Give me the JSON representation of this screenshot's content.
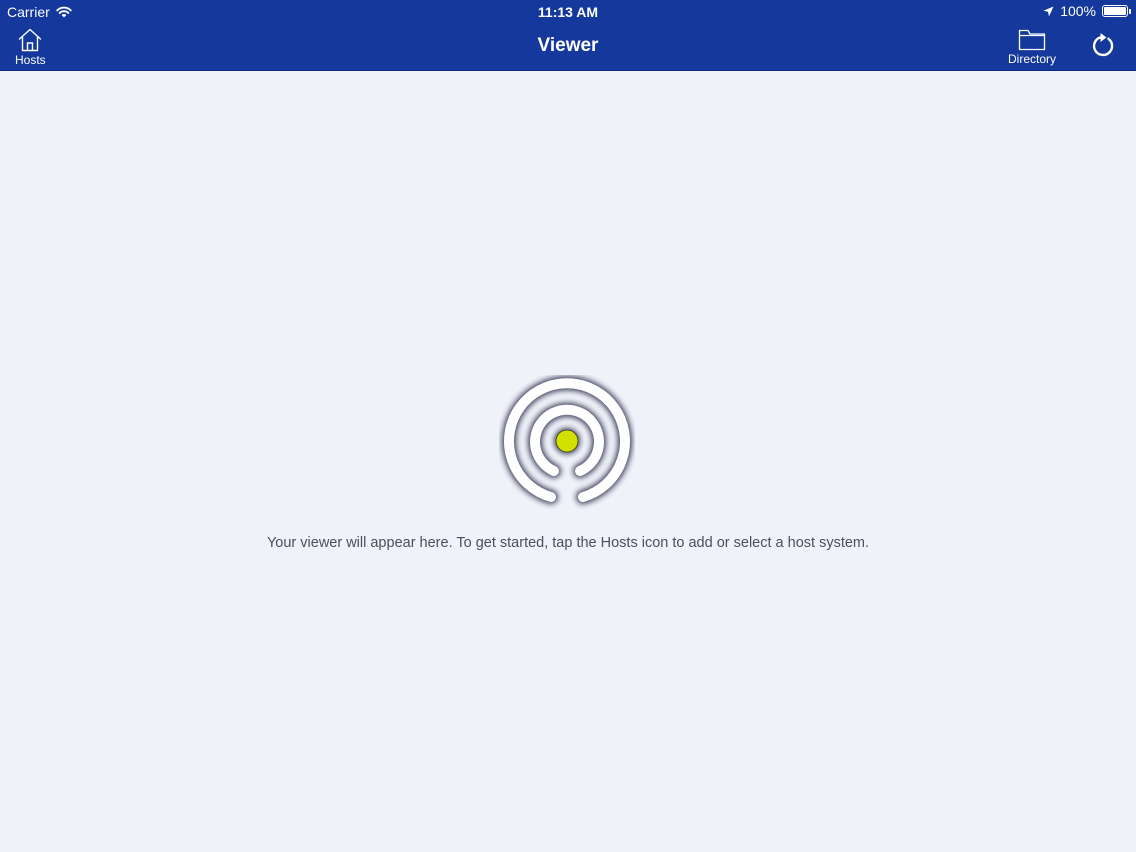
{
  "status_bar": {
    "carrier": "Carrier",
    "time": "11:13 AM",
    "battery": "100%",
    "icons": [
      "wifi-icon",
      "location-arrow-icon",
      "battery-icon"
    ]
  },
  "navbar": {
    "title": "Viewer",
    "left_button": {
      "label": "Hosts",
      "icon": "home-icon"
    },
    "right_buttons": [
      {
        "label": "Directory",
        "icon": "folder-icon"
      },
      {
        "label": "",
        "icon": "refresh-icon"
      }
    ]
  },
  "main": {
    "message": "Your viewer will appear here. To get started, tap the Hosts icon to add or select a host system.",
    "logo_icon": "broadcast-logo-icon"
  },
  "colors": {
    "navbar_bg": "#14389b",
    "content_bg": "#eff2f9",
    "logo_dot": "#d2e000",
    "text": "#4b4f5c"
  }
}
